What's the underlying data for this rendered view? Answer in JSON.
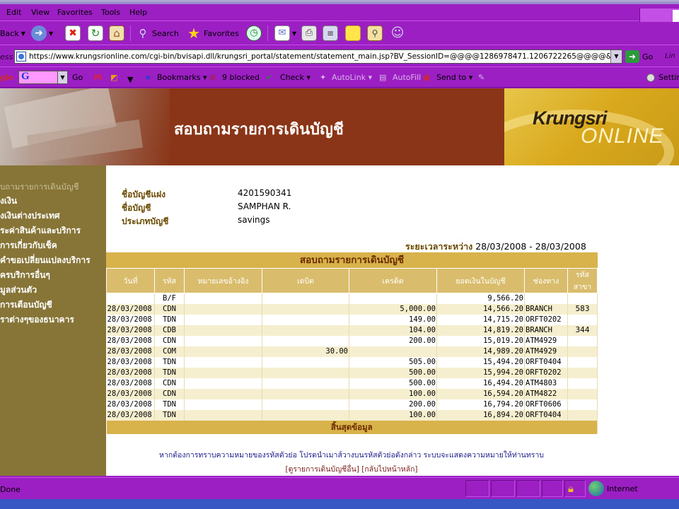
{
  "menubar": {
    "items": [
      "Edit",
      "View",
      "Favorites",
      "Tools",
      "Help"
    ]
  },
  "toolbar": {
    "back_label": "Back",
    "search_label": "Search",
    "favorites_label": "Favorites"
  },
  "address": {
    "label": "ess",
    "url": "https://www.krungsrionline.com/cgi-bin/bvisapi.dll/krungsri_portal/statement/statement_main.jsp?BV_SessionID=@@@@1286978471.1206722265@@@@&BV_EngineID=",
    "go_label": "Go",
    "links_label": "Lin"
  },
  "googlebar": {
    "brand_fragment": "gle",
    "search_value": "G",
    "go_label": "Go",
    "bookmarks_label": "Bookmarks",
    "blocked_label": "9 blocked",
    "check_label": "Check",
    "autolink_label": "AutoLink",
    "autofill_label": "AutoFill",
    "sendto_label": "Send to",
    "settings_label": "Settin"
  },
  "banner": {
    "title": "สอบถามรายการเดินบัญชี",
    "logo_line1": "Krungsri",
    "logo_line2": "ONLINE"
  },
  "sidenav": {
    "items": [
      "บถามรายการเดินบัญชี",
      "งเงิน",
      "งเงินต่างประเทศ",
      "ระค่าสินค้าและบริการ",
      "การเกี่ยวกับเช็ค",
      "คำขอเปลี่ยนแปลงบริการ",
      "ครบริการอื่นๆ",
      "มูลส่วนตัว",
      "การเตือนบัญชี",
      "ราต่างๆของธนาคาร"
    ]
  },
  "account": {
    "name_label": "ชื่อบัญชีแฝง",
    "name_value": "4201590341",
    "holder_label": "ชื่อบัญชี",
    "holder_value": "SAMPHAN R.",
    "type_label": "ประเภทบัญชี",
    "type_value": "savings"
  },
  "period": {
    "label": "ระยะเวลาระหว่าง",
    "value": "28/03/2008 - 28/03/2008"
  },
  "statement": {
    "title": "สอบถามรายการเดินบัญชี",
    "columns": [
      "วันที่",
      "รหัส",
      "หมายเลขอ้างอิง",
      "เดบิต",
      "เครดิต",
      "ยอดเงินในบัญชี",
      "ช่องทาง",
      "รหัส สาขา"
    ],
    "rows": [
      [
        "",
        "B/F",
        "",
        "",
        "",
        "9,566.20",
        "",
        ""
      ],
      [
        "28/03/2008",
        "CDN",
        "",
        "",
        "5,000.00",
        "14,566.20",
        "BRANCH",
        "583"
      ],
      [
        "28/03/2008",
        "TDN",
        "",
        "",
        "149.00",
        "14,715.20",
        "ORFT0202",
        ""
      ],
      [
        "28/03/2008",
        "CDB",
        "",
        "",
        "104.00",
        "14,819.20",
        "BRANCH",
        "344"
      ],
      [
        "28/03/2008",
        "CDN",
        "",
        "",
        "200.00",
        "15,019.20",
        "ATM4929",
        ""
      ],
      [
        "28/03/2008",
        "COM",
        "",
        "30.00",
        "",
        "14,989.20",
        "ATM4929",
        ""
      ],
      [
        "28/03/2008",
        "TDN",
        "",
        "",
        "505.00",
        "15,494.20",
        "ORFT0404",
        ""
      ],
      [
        "28/03/2008",
        "TDN",
        "",
        "",
        "500.00",
        "15,994.20",
        "ORFT0202",
        ""
      ],
      [
        "28/03/2008",
        "CDN",
        "",
        "",
        "500.00",
        "16,494.20",
        "ATM4803",
        ""
      ],
      [
        "28/03/2008",
        "CDN",
        "",
        "",
        "100.00",
        "16,594.20",
        "ATM4822",
        ""
      ],
      [
        "28/03/2008",
        "TDN",
        "",
        "",
        "200.00",
        "16,794.20",
        "ORFT0606",
        ""
      ],
      [
        "28/03/2008",
        "TDN",
        "",
        "",
        "100.00",
        "16,894.20",
        "ORFT0404",
        ""
      ]
    ],
    "footer": "สิ้นสุดข้อมูล"
  },
  "note": "หากต้องการทราบความหมายของรหัสตัวย่อ โปรดนำเมาส์วางบนรหัสตัวย่อดังกล่าว ระบบจะแสดงความหมายให้ท่านทราบ",
  "links": {
    "other_statement": "[ดูรายการเดินบัญชีอื่น]",
    "back_home": "[กลับไปหน้าหลัก]"
  },
  "statusbar": {
    "status": "Done",
    "zone": "Internet"
  }
}
